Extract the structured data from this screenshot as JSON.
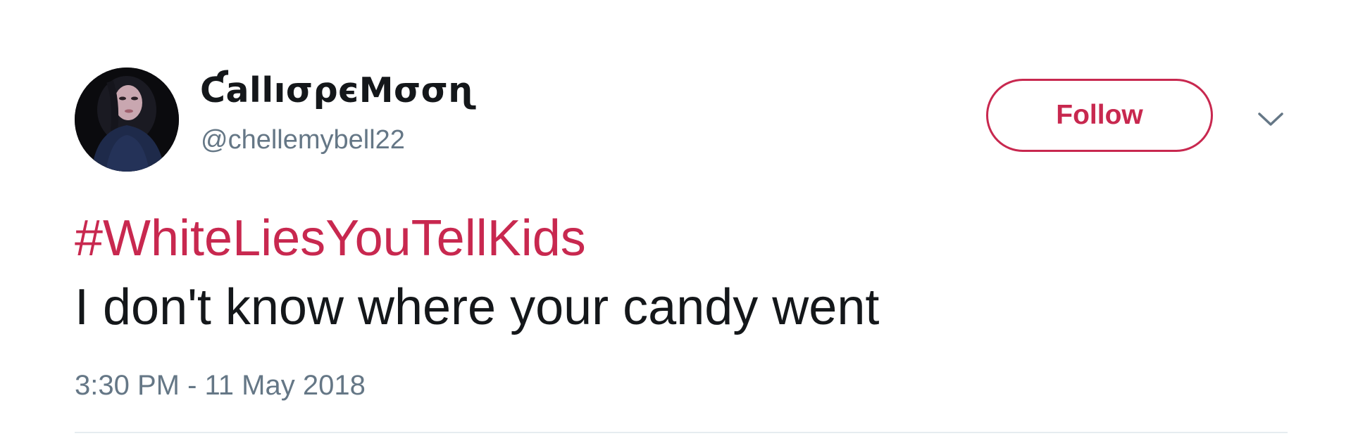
{
  "user": {
    "display_name": "ƇallıσρєMσσɳ",
    "handle": "@chellemybell22",
    "avatar_icon": "profile-photo"
  },
  "actions": {
    "follow_label": "Follow",
    "more_icon": "chevron-down-icon"
  },
  "tweet": {
    "hashtag": "#WhiteLiesYouTellKids",
    "text": "I don't know where your candy went",
    "timestamp": "3:30 PM - 11 May 2018"
  },
  "colors": {
    "accent": "#c8284f",
    "text": "#14171a",
    "secondary": "#657786",
    "divider": "#e6ecf0"
  }
}
